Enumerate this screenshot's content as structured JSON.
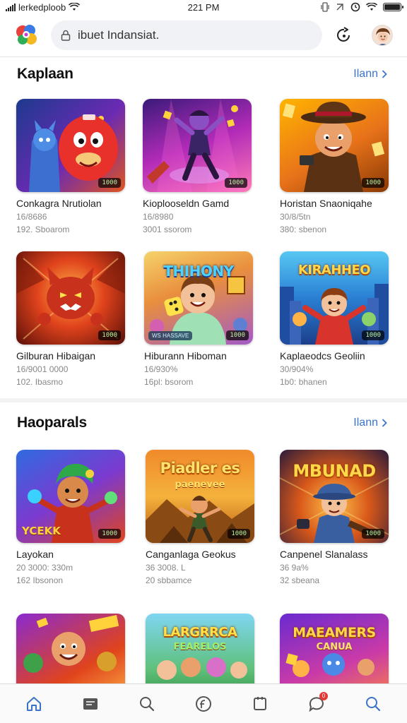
{
  "status": {
    "carrier": "lerkedploob",
    "time": "221 PM"
  },
  "search": {
    "value": "ibuet Indansiat."
  },
  "sections": [
    {
      "title": "Kaplaan",
      "more_label": "Ilann",
      "items": [
        {
          "title": "Conkagra Nrutiolan",
          "meta": "16/8686",
          "sub": "192. Sboarom",
          "badge": "1000",
          "art": "red-monster"
        },
        {
          "title": "Kioplooseldn Gamd",
          "meta": "16/8980",
          "sub": "3001 ssorom",
          "badge": "1000",
          "art": "dancer"
        },
        {
          "title": "Horistan Snaoniqahe",
          "meta": "30/8/5tn",
          "sub": "380: sbenon",
          "badge": "1000",
          "art": "cowboy"
        },
        {
          "title": "Gilburan Hibaigan",
          "meta": "16/9001 0000",
          "sub": "102. Ibasmo",
          "badge": "1000",
          "art": "fire-cat"
        },
        {
          "title": "Hiburann Hiboman",
          "meta": "16/930%",
          "sub": "16pl: bsorom",
          "badge": "1000",
          "art": "dice-kid",
          "art_title": "THIHONY",
          "chip": "WS HASSAVE"
        },
        {
          "title": "Kaplaeodcs Geoliin",
          "meta": "30/904%",
          "sub": "1b0: bhanen",
          "badge": "1000",
          "art": "hero-city",
          "art_title": "KIRAHHEO"
        }
      ]
    },
    {
      "title": "Haoparals",
      "more_label": "Ilann",
      "items": [
        {
          "title": "Layokan",
          "meta": "20 3000: 330m",
          "sub": "162 Ibsonon",
          "badge": "1000",
          "art": "explorer",
          "art_tag": "YCEKK"
        },
        {
          "title": "Canganlaga Geokus",
          "meta": "36 3008. L",
          "sub": "20 sbbamce",
          "badge": "1000",
          "art": "desert",
          "art_title": "Piadler es",
          "art_subtitle": "paenevee"
        },
        {
          "title": "Canpenel Slanalass",
          "meta": "36 9a%",
          "sub": "32 sbeana",
          "badge": "1000",
          "art": "detective",
          "art_title": "MBUNAD"
        },
        {
          "title": "",
          "meta": "",
          "sub": "",
          "badge": "",
          "art": "party"
        },
        {
          "title": "",
          "meta": "",
          "sub": "",
          "badge": "",
          "art": "green-team",
          "art_title": "LARGRRCA",
          "art_subtitle": "FEARELOS"
        },
        {
          "title": "",
          "meta": "",
          "sub": "",
          "badge": "",
          "art": "purple-team",
          "art_title": "MAEAMERS",
          "art_subtitle": "CANUA"
        }
      ]
    }
  ],
  "bottom_nav": {
    "notification_count": "0",
    "items": [
      "home-icon",
      "feed-icon",
      "search-icon",
      "currency-icon",
      "tablet-icon",
      "chat-icon",
      "search-alt-icon"
    ]
  }
}
